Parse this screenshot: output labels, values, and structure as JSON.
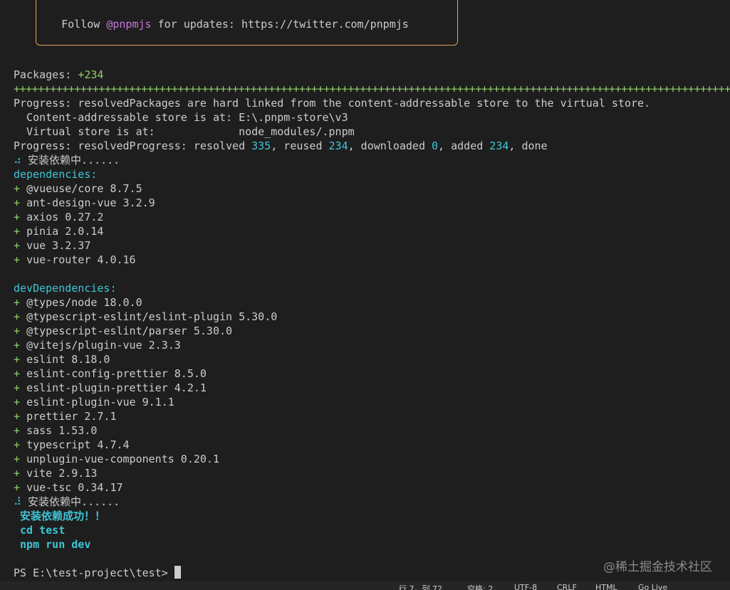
{
  "notice": {
    "prefix": "Follow ",
    "handle": "@pnpmjs",
    "suffix": " for updates: https://twitter.com/pnpmjs"
  },
  "packages_line": {
    "label": "Packages: ",
    "value": "+234"
  },
  "progress_bar": "+++++++++++++++++++++++++++++++++++++++++++++++++++++++++++++++++++++++++++++++++++++++++++++++++++++++++++++++++++++++++++++++++++++++",
  "progress_linked": "Progress: resolvedPackages are hard linked from the content-addressable store to the virtual store.",
  "store_line": "  Content-addressable store is at: E:\\.pnpm-store\\v3",
  "virtual_line": "  Virtual store is at:             node_modules/.pnpm",
  "progress_resolved": {
    "prefix": "Progress: resolvedProgress: resolved ",
    "resolved": "335",
    "reused_label": ", reused ",
    "reused": "234",
    "downloaded_label": ", downloaded ",
    "downloaded": "0",
    "added_label": ", added ",
    "added": "234",
    "suffix": ", done"
  },
  "installing_1": {
    "spinner": "⠴",
    "text": "安装依赖中......"
  },
  "dependencies_header": "dependencies:",
  "dependencies": [
    "@vueuse/core 8.7.5",
    "ant-design-vue 3.2.9",
    "axios 0.27.2",
    "pinia 2.0.14",
    "vue 3.2.37",
    "vue-router 4.0.16"
  ],
  "dev_dependencies_header": "devDependencies:",
  "dev_dependencies": [
    "@types/node 18.0.0",
    "@typescript-eslint/eslint-plugin 5.30.0",
    "@typescript-eslint/parser 5.30.0",
    "@vitejs/plugin-vue 2.3.3",
    "eslint 8.18.0",
    "eslint-config-prettier 8.5.0",
    "eslint-plugin-prettier 4.2.1",
    "eslint-plugin-vue 9.1.1",
    "prettier 2.7.1",
    "sass 1.53.0",
    "typescript 4.7.4",
    "unplugin-vue-components 0.20.1",
    "vite 2.9.13",
    "vue-tsc 0.34.17"
  ],
  "installing_2": {
    "spinner": "⠼",
    "text": "安装依赖中......"
  },
  "success": [
    " 安装依赖成功！！",
    " cd test",
    " npm run dev"
  ],
  "prompt": "PS E:\\test-project\\test> ",
  "watermark": "@稀土掘金技术社区",
  "statusbar": {
    "position": "行 7，列 72",
    "spaces": "空格: 2",
    "encoding": "UTF-8",
    "eol": "CRLF",
    "language": "HTML",
    "extra": "Go Live"
  }
}
